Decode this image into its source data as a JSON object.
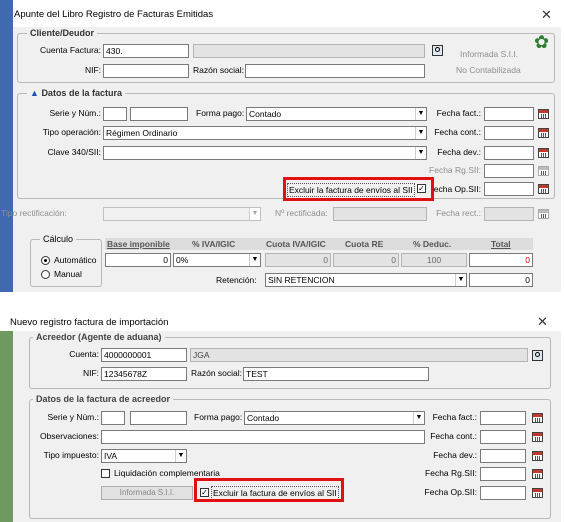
{
  "dialog1": {
    "title": "Apunte del Libro Registro de Facturas Emitidas",
    "cliente": {
      "group_title": "Cliente/Deudor",
      "cuenta_label": "Cuenta Factura:",
      "cuenta_value": "430.",
      "nif_label": "NIF:",
      "nif_value": "",
      "razon_label": "Razón social:",
      "razon_value": "",
      "informada": "Informada S.I.I.",
      "no_contabilizada": "No Contabilizada"
    },
    "datos": {
      "group_title": "Datos de la factura",
      "serie_label": "Serie y Núm.:",
      "forma_pago_label": "Forma pago:",
      "forma_pago_value": "Contado",
      "tipo_op_label": "Tipo operación:",
      "tipo_op_value": "Régimen Ordinario",
      "clave_label": "Clave 340/SII:",
      "clave_value": "",
      "fecha_fact_label": "Fecha fact.:",
      "fecha_cont_label": "Fecha cont.:",
      "fecha_dev_label": "Fecha dev.:",
      "fecha_rg_label": "Fecha Rg.SII:",
      "fecha_op_label": "echa Op.SII:",
      "excluir_label": "Excluir la factura de envíos al SII",
      "excluir_checked": true
    },
    "rectif": {
      "tipo_label": "Tipo rectificación:",
      "nro_label": "Nº rectificada:",
      "fecha_label": "Fecha rect.:"
    },
    "calculo": {
      "group_title": "Cálculo",
      "automatico": "Automático",
      "manual": "Manual",
      "headers": [
        "Base imponible",
        "% IVA/IGIC",
        "Cuota IVA/IGIC",
        "Cuota RE",
        "% Deduc.",
        "Total"
      ],
      "base": "0",
      "iva": "0%",
      "cuota_iva": "0",
      "cuota_re": "0",
      "deduc": "100",
      "total": "0",
      "retencion_label": "Retención:",
      "retencion_value": "SIN RETENCION",
      "retencion_total": "0"
    }
  },
  "dialog2": {
    "title": "Nuevo registro factura de importación",
    "acreedor": {
      "group_title": "Acreedor (Agente de aduana)",
      "cuenta_label": "Cuenta:",
      "cuenta_value": "4000000001",
      "cuenta_name": "JGA",
      "nif_label": "NIF:",
      "nif_value": "12345678Z",
      "razon_label": "Razón social:",
      "razon_value": "TEST"
    },
    "datos": {
      "group_title": "Datos de la factura de acreedor",
      "serie_label": "Serie y Núm.:",
      "forma_pago_label": "Forma pago:",
      "forma_pago_value": "Contado",
      "observaciones_label": "Observaciones:",
      "tipo_impuesto_label": "Tipo impuesto:",
      "tipo_impuesto_value": "IVA",
      "liquidacion_label": "Liquidación complementaria",
      "informada_btn": "Informada S.I.I.",
      "excluir_label": "Excluir la factura de envíos al SII",
      "excluir_checked": true,
      "fecha_fact_label": "Fecha fact.:",
      "fecha_cont_label": "Fecha cont.:",
      "fecha_dev_label": "Fecha dev.:",
      "fecha_rg_label": "Fecha Rg.SII:",
      "fecha_op_label": "Fecha Op.SII:"
    }
  },
  "colors": {
    "stripe1": "#3f6ab0",
    "stripe2": "#6f9a5f",
    "highlight": "#e01010",
    "gear": "#2e7d32"
  }
}
